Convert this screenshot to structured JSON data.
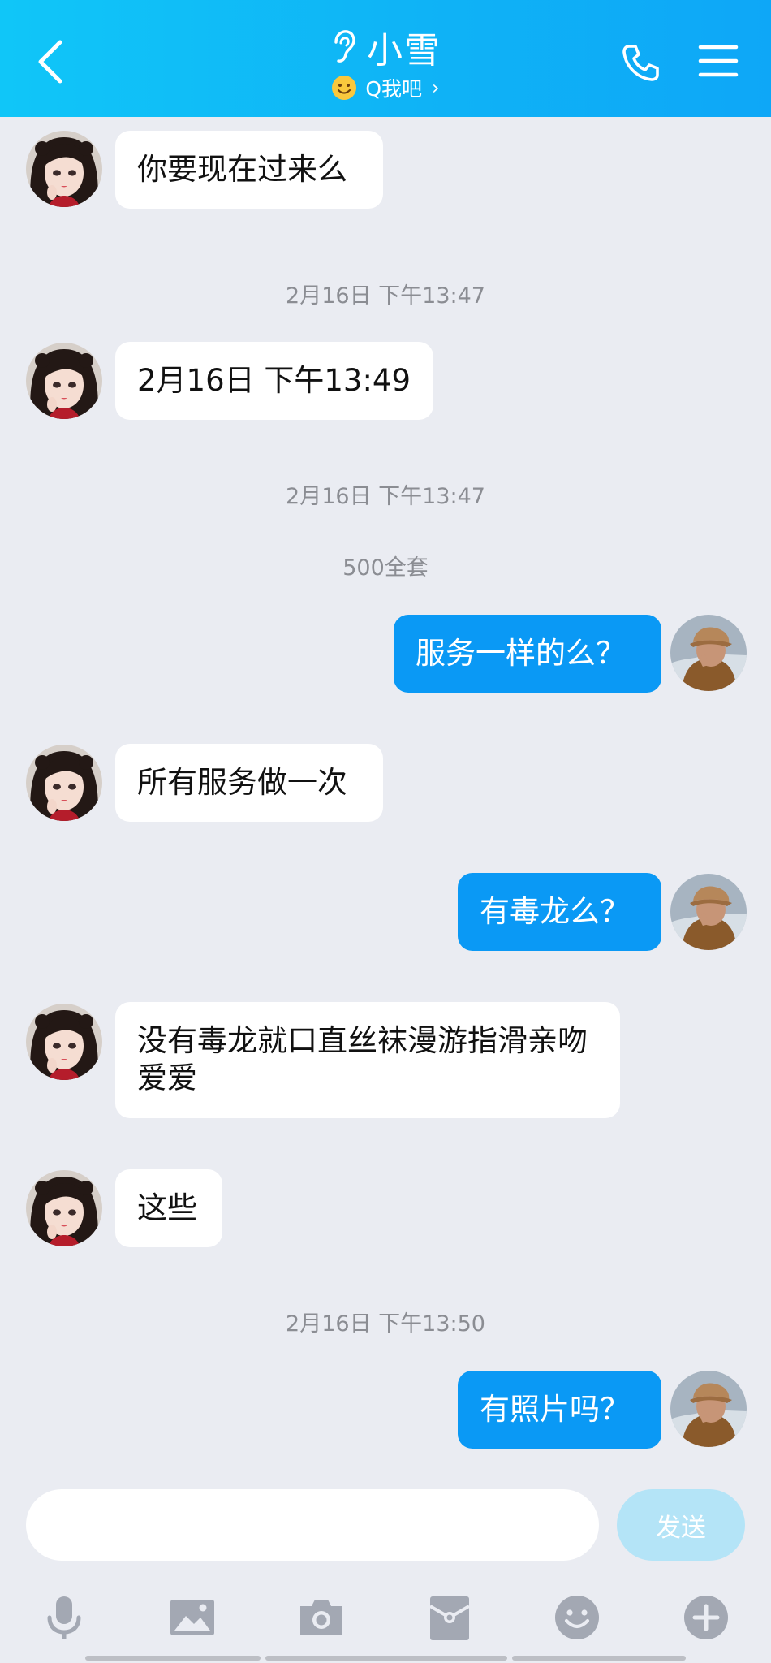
{
  "header": {
    "title": "小雪",
    "subtitle": "Q我吧",
    "icons": [
      "back-chevron-icon",
      "ear-icon",
      "smile-emoji-icon",
      "phone-icon",
      "menu-icon"
    ]
  },
  "messages": [
    {
      "type": "in",
      "text": "你要现在过来么"
    },
    {
      "type": "timestamp",
      "text": "2月16日 下午13:47"
    },
    {
      "type": "in",
      "text": "2月16日 下午13:49"
    },
    {
      "type": "timestamp",
      "text": "2月16日 下午13:47"
    },
    {
      "type": "system",
      "text": "500全套"
    },
    {
      "type": "out",
      "text": "服务一样的么？"
    },
    {
      "type": "in",
      "text": "所有服务做一次"
    },
    {
      "type": "out",
      "text": "有毒龙么？"
    },
    {
      "type": "in",
      "text": "没有毒龙就口直丝袜漫游指滑亲吻爱爱"
    },
    {
      "type": "in",
      "text": "这些"
    },
    {
      "type": "timestamp",
      "text": "2月16日 下午13:50"
    },
    {
      "type": "out",
      "text": "有照片吗？"
    }
  ],
  "input": {
    "value": "",
    "placeholder": "",
    "send_label": "发送"
  },
  "toolbar": [
    "microphone-icon",
    "image-icon",
    "camera-icon",
    "red-packet-icon",
    "emoji-icon",
    "plus-icon"
  ],
  "colors": {
    "header_start": "#10c6f8",
    "header_end": "#0ea7f7",
    "background": "#eaecf2",
    "outgoing_bubble": "#0a99f5",
    "incoming_bubble": "#ffffff",
    "send_button": "#b4e4f7",
    "toolbar_icon": "#a3a8b3"
  }
}
